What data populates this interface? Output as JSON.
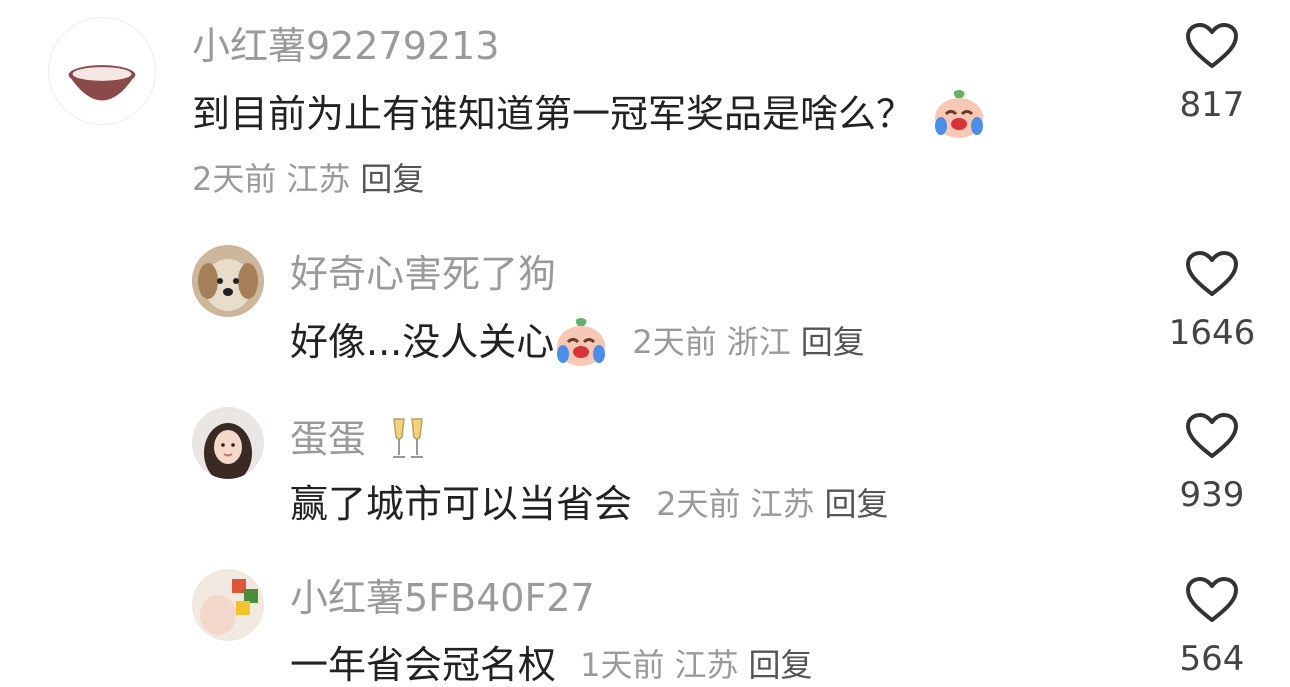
{
  "comments": [
    {
      "username": "小红薯92279213",
      "text": "到目前为止有谁知道第一冠军奖品是啥么？",
      "emoji": "crying-laugh-emoji",
      "time": "2天前",
      "location": "江苏",
      "reply_label": "回复",
      "likes": "817",
      "avatar": "bowl-avatar"
    },
    {
      "username": "好奇心害死了狗",
      "text": "好像...没人关心",
      "emoji": "crying-laugh-emoji",
      "time": "2天前",
      "location": "浙江",
      "reply_label": "回复",
      "likes": "1646",
      "avatar": "dog-avatar"
    },
    {
      "username": "蛋蛋",
      "name_emoji": "champagne-emoji",
      "text": "赢了城市可以当省会",
      "time": "2天前",
      "location": "江苏",
      "reply_label": "回复",
      "likes": "939",
      "avatar": "girl-avatar"
    },
    {
      "username": "小红薯5FB40F27",
      "text": "一年省会冠名权",
      "time": "1天前",
      "location": "江苏",
      "reply_label": "回复",
      "likes": "564",
      "avatar": "baby-avatar"
    }
  ],
  "colors": {
    "name": "#9a9a9a",
    "text": "#222222",
    "meta": "#9a9a9a",
    "heart_stroke": "#333333"
  }
}
